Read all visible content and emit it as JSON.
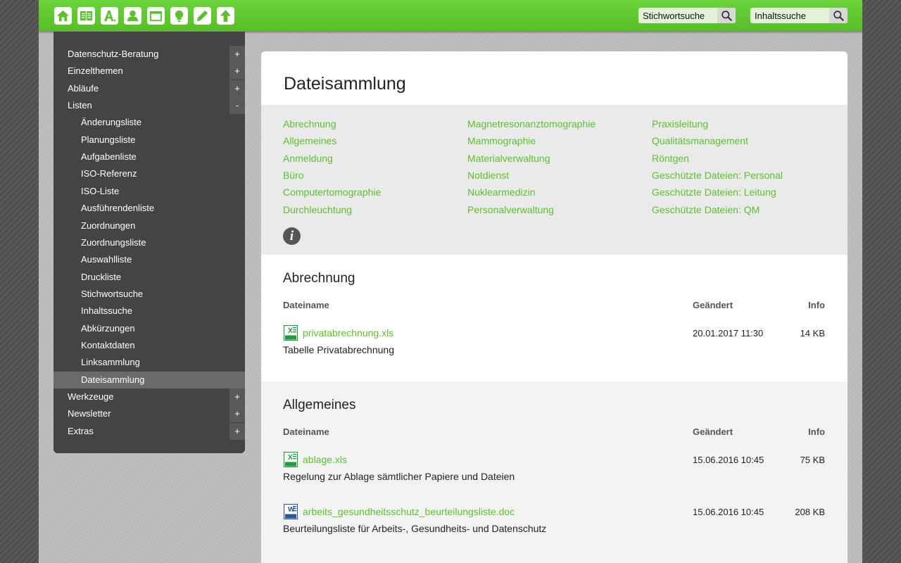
{
  "topbar": {
    "icons": [
      "home-icon",
      "book-icon",
      "font-icon",
      "user-icon",
      "window-icon",
      "lightbulb-icon",
      "pencil-icon",
      "upload-icon"
    ],
    "search1_placeholder": "Stichwortsuche",
    "search2_placeholder": "Inhaltssuche"
  },
  "sidebar": {
    "items": [
      {
        "label": "Datenschutz-Beratung",
        "toggle": "+"
      },
      {
        "label": "Einzelthemen",
        "toggle": "+"
      },
      {
        "label": "Abläufe",
        "toggle": "+"
      },
      {
        "label": "Listen",
        "toggle": "-"
      },
      {
        "label": "Änderungsliste"
      },
      {
        "label": "Planungsliste"
      },
      {
        "label": "Aufgabenliste"
      },
      {
        "label": "ISO-Referenz"
      },
      {
        "label": "ISO-Liste"
      },
      {
        "label": "Ausführendenliste"
      },
      {
        "label": "Zuordnungen"
      },
      {
        "label": "Zuordnungsliste"
      },
      {
        "label": "Auswahlliste"
      },
      {
        "label": "Druckliste"
      },
      {
        "label": "Stichwortsuche"
      },
      {
        "label": "Inhaltssuche"
      },
      {
        "label": "Abkürzungen"
      },
      {
        "label": "Kontaktdaten"
      },
      {
        "label": "Linksammlung"
      },
      {
        "label": "Dateisammlung",
        "active": true
      },
      {
        "label": "Werkzeuge",
        "toggle": "+"
      },
      {
        "label": "Newsletter",
        "toggle": "+"
      },
      {
        "label": "Extras",
        "toggle": "+"
      }
    ]
  },
  "main": {
    "title": "Dateisammlung",
    "categories": {
      "col1": [
        "Abrechnung",
        "Allgemeines",
        "Anmeldung",
        "Büro",
        "Computertomographie",
        "Durchleuchtung"
      ],
      "col2": [
        "Magnetresonanztomographie",
        "Mammographie",
        "Materialverwaltung",
        "Notdienst",
        "Nuklearmedizin",
        "Personalverwaltung"
      ],
      "col3": [
        "Praxisleitung",
        "Qualitätsmanagement",
        "Röntgen",
        "Geschützte Dateien: Personal",
        "Geschützte Dateien: Leitung",
        "Geschützte Dateien: QM"
      ]
    },
    "info_icon_glyph": "i",
    "columns": {
      "name": "Dateiname",
      "changed": "Geändert",
      "info": "Info"
    },
    "sections": [
      {
        "title": "Abrechnung",
        "files": [
          {
            "name": "privatabrechnung.xls",
            "type": "xls",
            "date": "20.01.2017 11:30",
            "size": "14 KB",
            "desc": "Tabelle Privatabrechnung"
          }
        ]
      },
      {
        "title": "Allgemeines",
        "files": [
          {
            "name": "ablage.xls",
            "type": "xls",
            "date": "15.06.2016 10:45",
            "size": "75 KB",
            "desc": "Regelung zur Ablage sämtlicher Papiere und Dateien"
          },
          {
            "name": "arbeits_gesundheitsschutz_beurteilungsliste.doc",
            "type": "doc",
            "date": "15.06.2016 10:45",
            "size": "208 KB",
            "desc": "Beurteilungsliste für Arbeits-, Gesundheits- und Datenschutz"
          }
        ]
      }
    ]
  },
  "colors": {
    "brand_green": "#5cc02e",
    "topbar_green": "#5fc92e",
    "sidebar_bg": "#444444",
    "sidebar_active": "#6a6a6a"
  }
}
